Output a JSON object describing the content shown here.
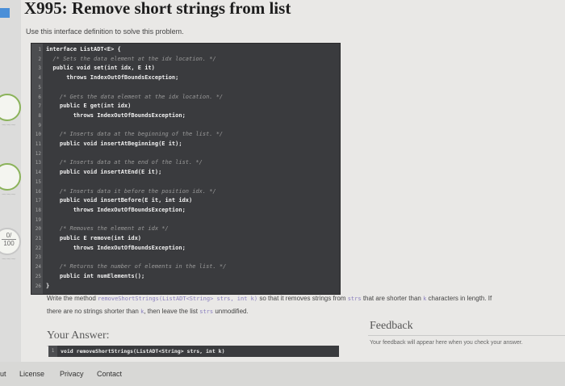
{
  "page": {
    "title": "X995: Remove short strings from list",
    "subtitle": "Use this interface definition to solve this problem."
  },
  "sidebar": {
    "score_numerator": "0/",
    "score_denominator": "100"
  },
  "interface_code": {
    "line_numbers": [
      "1",
      "2",
      "3",
      "4",
      "5",
      "6",
      "7",
      "8",
      "9",
      "10",
      "11",
      "12",
      "13",
      "14",
      "15",
      "16",
      "17",
      "18",
      "19",
      "20",
      "21",
      "22",
      "23",
      "24",
      "25",
      "26"
    ],
    "lines": [
      "interface ListADT<E> {",
      "  /* Sets the data element at the idx location. */",
      "  public void set(int idx, E it)",
      "      throws IndexOutOfBoundsException;",
      "",
      "    /* Gets the data element at the idx location. */",
      "    public E get(int idx)",
      "        throws IndexOutOfBoundsException;",
      "",
      "    /* Inserts data at the beginning of the list. */",
      "    public void insertAtBeginning(E it);",
      "",
      "    /* Inserts data at the end of the list. */",
      "    public void insertAtEnd(E it);",
      "",
      "    /* Inserts data it before the position idx. */",
      "    public void insertBefore(E it, int idx)",
      "        throws IndexOutOfBoundsException;",
      "",
      "    /* Removes the element at idx */",
      "    public E remove(int idx)",
      "        throws IndexOutOfBoundsException;",
      "",
      "    /* Returns the number of elements in the list. */",
      "    public int numElements();",
      "}"
    ]
  },
  "description": {
    "prefix": "Write the method",
    "method_sig": "removeShortStrings(ListADT<String> strs, int k)",
    "middle": "so that it removes strings from",
    "strs": "strs",
    "middle2": "that are shorter than",
    "k": "k",
    "suffix": "characters in length. If",
    "line2_prefix": "there are no strings shorter than",
    "line2_k": "k",
    "line2_middle": ", then leave the list",
    "line2_strs": "strs",
    "line2_suffix": "unmodified."
  },
  "answer": {
    "label": "Your Answer:",
    "line_number": "1",
    "code": "void removeShortStrings(ListADT<String> strs, int k)"
  },
  "feedback": {
    "title": "Feedback",
    "text": "Your feedback will appear here when you check your answer."
  },
  "footer": {
    "left_partial": "ut",
    "license": "License",
    "privacy": "Privacy",
    "contact": "Contact"
  },
  "colors": {
    "editor_bg": "#3a3b3e",
    "accent_green": "#8bb35a",
    "code_keyword": "#8a7fbf"
  }
}
